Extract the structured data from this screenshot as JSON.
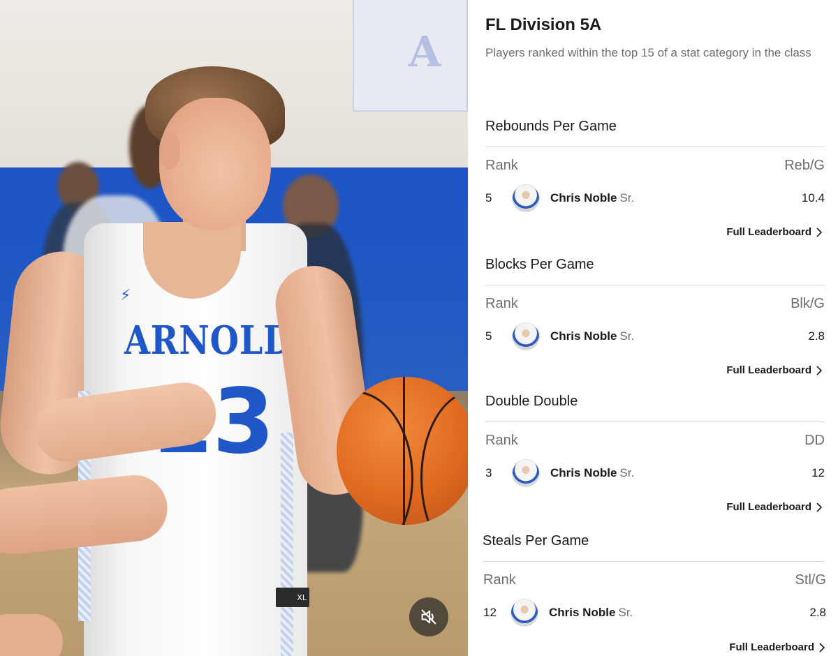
{
  "photo": {
    "jersey_name": "ARNOLD",
    "jersey_number": "13",
    "jersey_size": "XL",
    "mute_icon": "speaker-muted-icon"
  },
  "panel": {
    "title": "FL Division 5A",
    "subtitle": "Players ranked within the top 15 of a stat category in the class",
    "link_label": "Full Leaderboard",
    "sections": [
      {
        "title": "Rebounds Per Game",
        "rank_header": "Rank",
        "stat_header": "Reb/G",
        "rank": "5",
        "player": "Chris Noble",
        "class": "Sr.",
        "value": "10.4"
      },
      {
        "title": "Blocks Per Game",
        "rank_header": "Rank",
        "stat_header": "Blk/G",
        "rank": "5",
        "player": "Chris Noble",
        "class": "Sr.",
        "value": "2.8"
      },
      {
        "title": "Double Double",
        "rank_header": "Rank",
        "stat_header": "DD",
        "rank": "3",
        "player": "Chris Noble",
        "class": "Sr.",
        "value": "12"
      },
      {
        "title": "Steals Per Game",
        "rank_header": "Rank",
        "stat_header": "Stl/G",
        "rank": "12",
        "player": "Chris Noble",
        "class": "Sr.",
        "value": "2.8"
      }
    ]
  },
  "colors": {
    "jersey_blue": "#2057c8",
    "text_primary": "#1a1a1a",
    "text_secondary": "#6b6d70",
    "divider": "#d6d7d9"
  }
}
